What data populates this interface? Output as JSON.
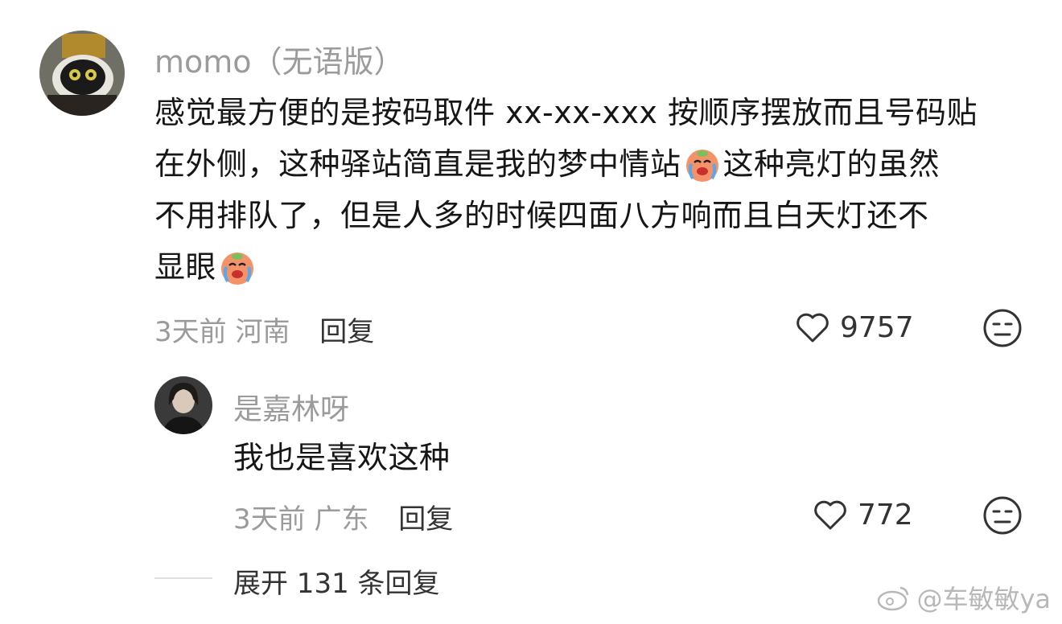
{
  "comment": {
    "username": "momo（无语版）",
    "text_lines": [
      "感觉最方便的是按码取件 xx-xx-xxx 按顺序摆放而且号码贴",
      "在外侧，这种驿站简直是我的梦中情站",
      "这种亮灯的虽然",
      "不用排队了，但是人多的时候四面八方响而且白天灯还不",
      "显眼"
    ],
    "time": "3天前",
    "location": "河南",
    "reply_label": "回复",
    "likes": "9757",
    "icons": {
      "like": "heart-icon",
      "dislike": "meh-face-icon",
      "emoji": "crying-face-emoji"
    }
  },
  "reply": {
    "username": "是嘉林呀",
    "text": "我也是喜欢这种",
    "time": "3天前",
    "location": "广东",
    "reply_label": "回复",
    "likes": "772"
  },
  "expand_label": "展开 131 条回复",
  "watermark": "@车敏敏ya",
  "colors": {
    "secondary_text": "#9b9b9b",
    "primary_text": "#161616",
    "emoji_orange": "#f4926a"
  }
}
